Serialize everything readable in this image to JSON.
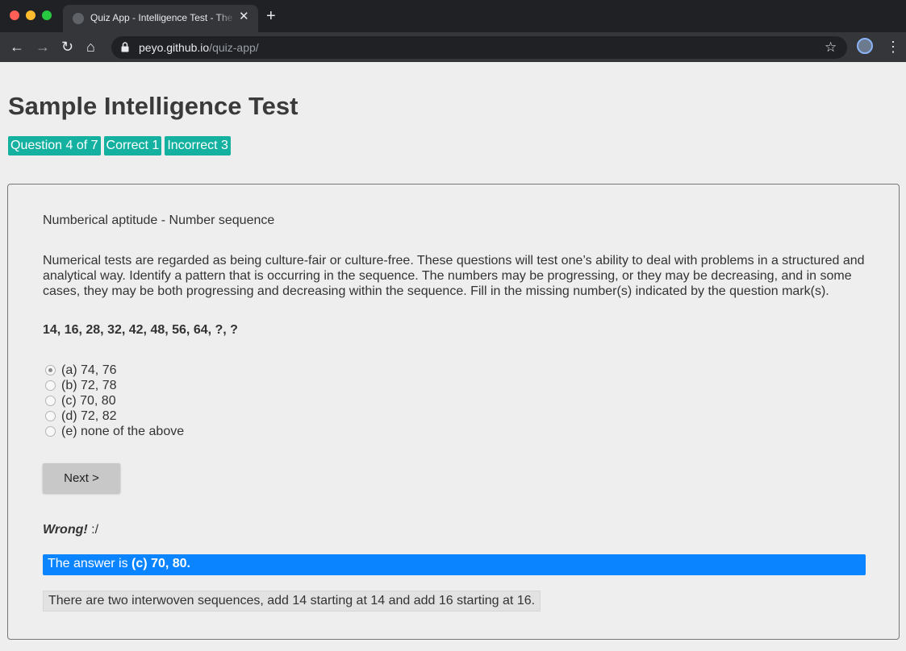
{
  "browser": {
    "tab_title": "Quiz App - Intelligence Test - The Best Quiz App Ever",
    "tab_close": "✕",
    "new_tab": "+",
    "url_host": "peyo.github.io",
    "url_path": "/quiz-app/",
    "icons": {
      "back": "←",
      "forward": "→",
      "reload": "↻",
      "home": "⌂",
      "star": "☆",
      "menu": "⋮"
    }
  },
  "page": {
    "title": "Sample Intelligence Test",
    "badges": {
      "question": "Question 4 of 7",
      "correct": "Correct 1",
      "incorrect": "Incorrect 3"
    }
  },
  "quiz": {
    "category": "Numberical aptitude - Number sequence",
    "description": "Numerical tests are regarded as being culture-fair or culture-free. These questions will test one’s ability to deal with problems in a structured and analytical way. Identify a pattern that is occurring in the sequence. The numbers may be progressing, or they may be decreasing, and in some cases, they may be both progressing and decreasing within the sequence. Fill in the missing number(s) indicated by the question mark(s).",
    "sequence": "14, 16, 28, 32, 42, 48, 56, 64, ?, ?",
    "options": [
      {
        "label": "(a) 74, 76",
        "selected": true
      },
      {
        "label": "(b) 72, 78",
        "selected": false
      },
      {
        "label": "(c) 70, 80",
        "selected": false
      },
      {
        "label": "(d) 72, 82",
        "selected": false
      },
      {
        "label": "(e) none of the above",
        "selected": false
      }
    ],
    "next_label": "Next >",
    "feedback": {
      "wrong_word": "Wrong!",
      "wrong_suffix": " :/"
    },
    "answer": {
      "prefix": "The answer is ",
      "value": "(c) 70, 80."
    },
    "explanation": "There are two interwoven sequences, add 14 starting at 14 and add 16 starting at 16."
  },
  "colors": {
    "badge": "#14b0a0",
    "answer_bar": "#0a84ff",
    "page_bg": "#eeeeee"
  }
}
